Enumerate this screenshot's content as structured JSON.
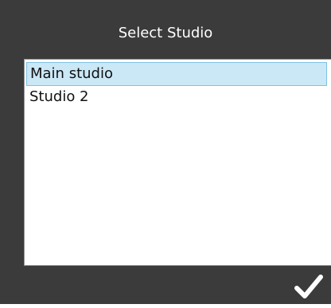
{
  "dialog": {
    "title": "Select Studio",
    "items": [
      {
        "label": "Main studio",
        "selected": true
      },
      {
        "label": "Studio 2",
        "selected": false
      }
    ],
    "confirm_icon": "checkmark-icon"
  },
  "colors": {
    "background": "#3b3b3b",
    "selection": "#cbe8f6",
    "selection_border": "#7fc0e3"
  }
}
